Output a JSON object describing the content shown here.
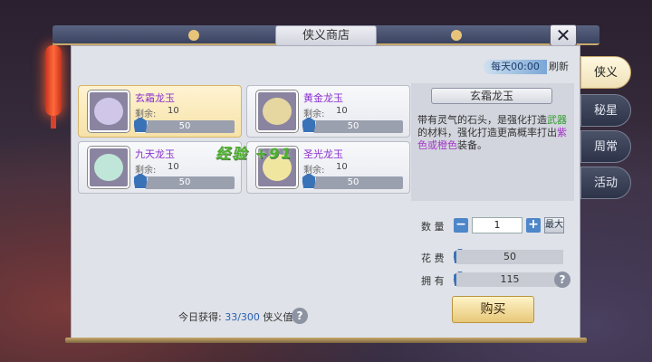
{
  "window": {
    "title": "侠义商店",
    "close_label": "✕"
  },
  "refresh": {
    "time": "每天00:00",
    "label": "刷新"
  },
  "side_tabs": [
    {
      "label": "侠义",
      "active": true
    },
    {
      "label": "秘星",
      "active": false
    },
    {
      "label": "周常",
      "active": false
    },
    {
      "label": "活动",
      "active": false
    }
  ],
  "items": [
    {
      "name": "玄霜龙玉",
      "remaining_label": "剩余:",
      "remaining": "10",
      "cost": "50",
      "gem_color": "#cfc6e8",
      "selected": true
    },
    {
      "name": "黄金龙玉",
      "remaining_label": "剩余:",
      "remaining": "10",
      "cost": "50",
      "gem_color": "#e6d7a0",
      "selected": false
    },
    {
      "name": "九天龙玉",
      "remaining_label": "剩余:",
      "remaining": "10",
      "cost": "50",
      "gem_color": "#bfe6d8",
      "selected": false
    },
    {
      "name": "圣光龙玉",
      "remaining_label": "剩余:",
      "remaining": "10",
      "cost": "50",
      "gem_color": "#f0e6a0",
      "selected": false
    }
  ],
  "exp_overlay": "经验 +91",
  "detail": {
    "title": "玄霜龙玉",
    "desc_1": "带有灵气的石头，是强化打造",
    "desc_green": "武器",
    "desc_2": "的材料，强化打造更高概率打出",
    "desc_purple": "紫色或橙色",
    "desc_3": "装备。"
  },
  "purchase": {
    "qty_label": "数  量",
    "qty_value": "1",
    "minus": "−",
    "plus": "+",
    "max_label": "最大",
    "cost_label": "花  费",
    "cost_value": "50",
    "own_label": "拥  有",
    "own_value": "115",
    "help": "?",
    "buy_label": "购买"
  },
  "today": {
    "label": "今日获得:",
    "count": "33/300",
    "unit": "侠义值",
    "help": "?"
  },
  "colors": {
    "accent_blue": "#4d86c9",
    "selected_gold": "#f6e2a8",
    "name_purple": "#8a2fd0"
  }
}
